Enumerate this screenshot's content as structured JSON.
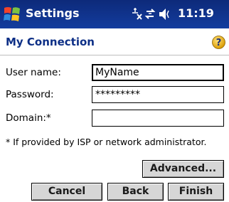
{
  "titlebar": {
    "app_title": "Settings",
    "clock": "11:19",
    "icons": [
      "windows-start-icon",
      "signal-off-icon",
      "connectivity-icon",
      "volume-icon"
    ]
  },
  "header": {
    "title": "My Connection",
    "help_icon": "help-icon"
  },
  "form": {
    "username_label": "User name:",
    "username_value": "MyName",
    "password_label": "Password:",
    "password_value": "*********",
    "domain_label": "Domain:*",
    "domain_value": "",
    "note": "* If provided by ISP or network administrator."
  },
  "buttons": {
    "advanced": "Advanced...",
    "cancel": "Cancel",
    "back": "Back",
    "finish": "Finish"
  },
  "colors": {
    "titlebar": "#133c9e",
    "header_text": "#0d2f86",
    "button_face": "#d6d6d6"
  }
}
